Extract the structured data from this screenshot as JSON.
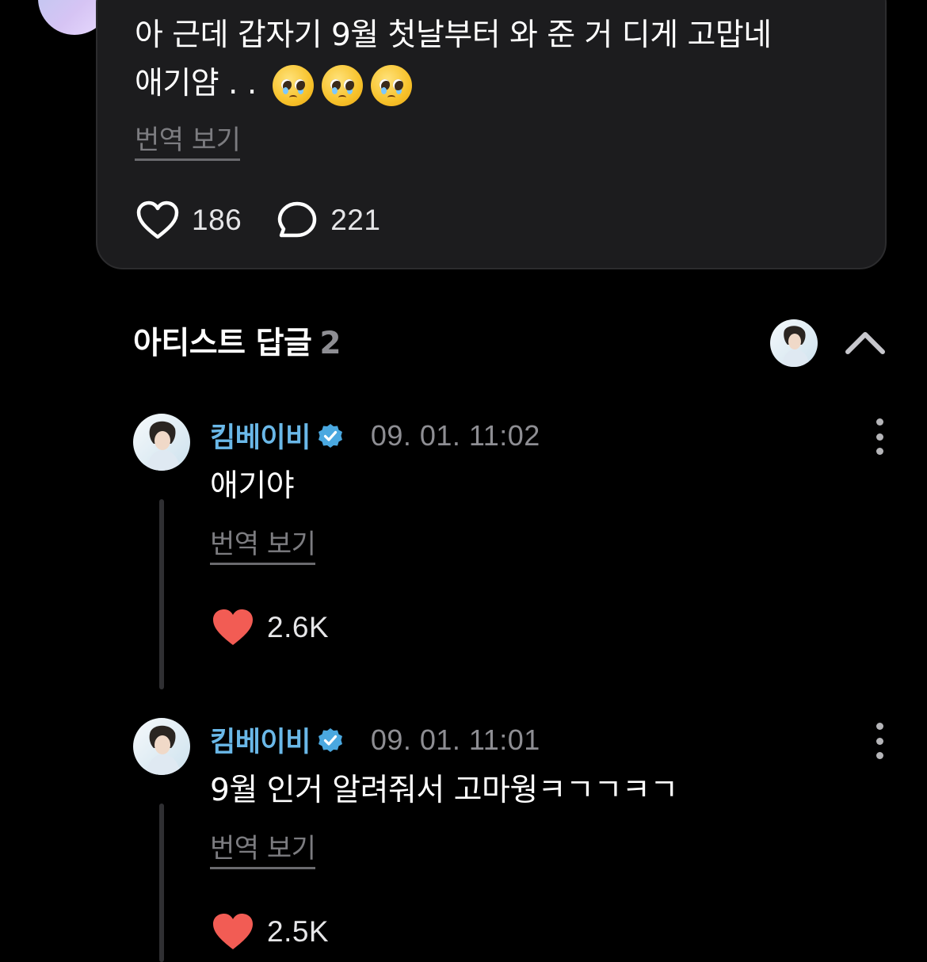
{
  "post": {
    "text_line1": "아 근데 갑자기 9월 첫날부터 와 준 거 디게 고맙네",
    "text_line2": "애기얌 . .",
    "emojis": [
      "pleading-face",
      "pleading-face",
      "pleading-face"
    ],
    "translate_label": "번역 보기",
    "like_count": "186",
    "comment_count": "221"
  },
  "replies_section": {
    "title": "아티스트 답글",
    "count": "2"
  },
  "replies": [
    {
      "author": "킴베이비",
      "time": "09. 01. 11:02",
      "text": "애기야",
      "translate_label": "번역 보기",
      "like_count": "2.6K"
    },
    {
      "author": "킴베이비",
      "time": "09. 01. 11:01",
      "text": "9월 인거 알려줘서 고마웡ㅋㄱㄱㅋㄱ",
      "translate_label": "번역 보기",
      "like_count": "2.5K"
    }
  ],
  "colors": {
    "background": "#000000",
    "card": "#1c1c1e",
    "artist_name": "#6ab8e8",
    "verified_badge": "#4aa8e0",
    "liked_heart": "#f25c54",
    "muted_text": "#8e8e93"
  },
  "icons": {
    "like": "heart-outline-icon",
    "comment": "speech-bubble-icon",
    "liked": "heart-filled-icon",
    "verified": "verified-badge-icon",
    "more": "vertical-ellipsis-icon",
    "collapse": "chevron-up-icon"
  }
}
